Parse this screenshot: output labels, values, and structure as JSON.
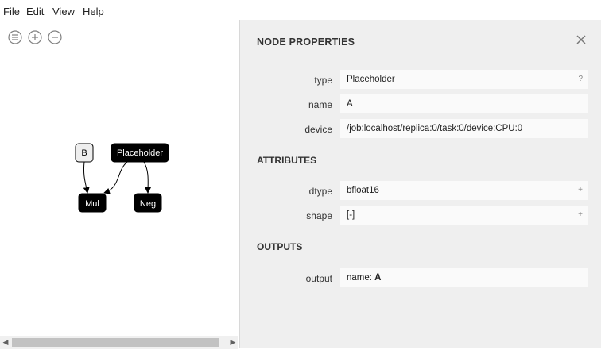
{
  "menu": [
    "File",
    "Edit",
    "View",
    "Help"
  ],
  "toolbar": {
    "icons": [
      "sidebar-icon",
      "zoom-in-icon",
      "zoom-out-icon"
    ]
  },
  "graph": {
    "nodes": {
      "b": "B",
      "placeholder": "Placeholder",
      "mul": "Mul",
      "neg": "Neg"
    }
  },
  "sidebar": {
    "title": "NODE PROPERTIES",
    "properties": [
      {
        "label": "type",
        "value": "Placeholder",
        "tag": "?"
      },
      {
        "label": "name",
        "value": "A"
      },
      {
        "label": "device",
        "value": "/job:localhost/replica:0/task:0/device:CPU:0"
      }
    ],
    "attributes_title": "ATTRIBUTES",
    "attributes": [
      {
        "label": "dtype",
        "value": "bfloat16",
        "tag": "+"
      },
      {
        "label": "shape",
        "value": "[-]",
        "tag": "+"
      }
    ],
    "outputs_title": "OUTPUTS",
    "outputs": [
      {
        "label": "output",
        "prefix": "name: ",
        "value": "A"
      }
    ]
  }
}
